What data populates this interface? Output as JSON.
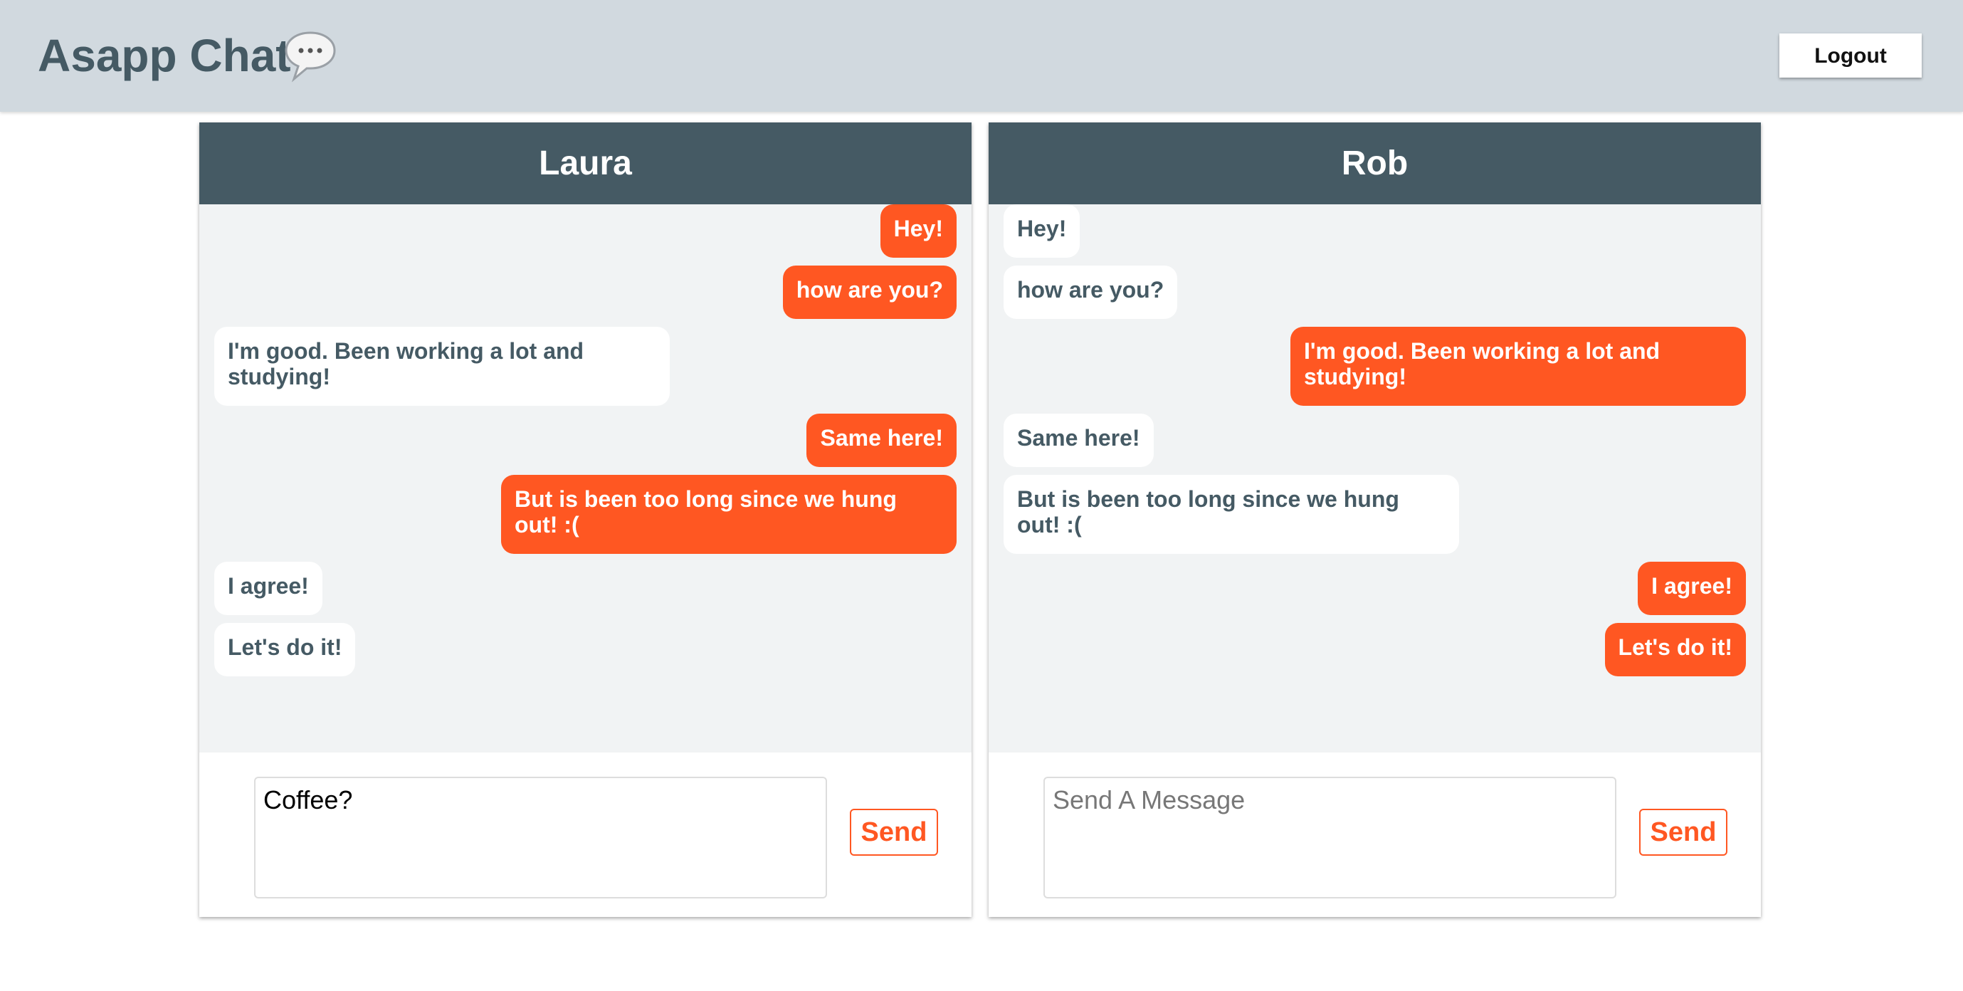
{
  "app": {
    "title": "Asapp Chat",
    "icon": "speech-bubble-icon",
    "logout_label": "Logout"
  },
  "colors": {
    "header_bg": "#d1d9df",
    "panel_header_bg": "#455a64",
    "accent": "#ff5722",
    "messages_bg": "#f1f3f4",
    "text_dark": "#455a64"
  },
  "panels": [
    {
      "name": "Laura",
      "messages": [
        {
          "text": "Hey!",
          "from": "me"
        },
        {
          "text": "how are you?",
          "from": "me"
        },
        {
          "text": "I'm good. Been working a lot and studying!",
          "from": "them"
        },
        {
          "text": "Same here!",
          "from": "me"
        },
        {
          "text": "But is been too long since we hung out! :(",
          "from": "me"
        },
        {
          "text": "I agree!",
          "from": "them"
        },
        {
          "text": "Let's do it!",
          "from": "them"
        }
      ],
      "input_value": "Coffee?",
      "input_placeholder": "Send A Message",
      "send_label": "Send"
    },
    {
      "name": "Rob",
      "messages": [
        {
          "text": "Hey!",
          "from": "them"
        },
        {
          "text": "how are you?",
          "from": "them"
        },
        {
          "text": "I'm good. Been working a lot and studying!",
          "from": "me"
        },
        {
          "text": "Same here!",
          "from": "them"
        },
        {
          "text": "But is been too long since we hung out! :(",
          "from": "them"
        },
        {
          "text": "I agree!",
          "from": "me"
        },
        {
          "text": "Let's do it!",
          "from": "me"
        }
      ],
      "input_value": "",
      "input_placeholder": "Send A Message",
      "send_label": "Send"
    }
  ]
}
